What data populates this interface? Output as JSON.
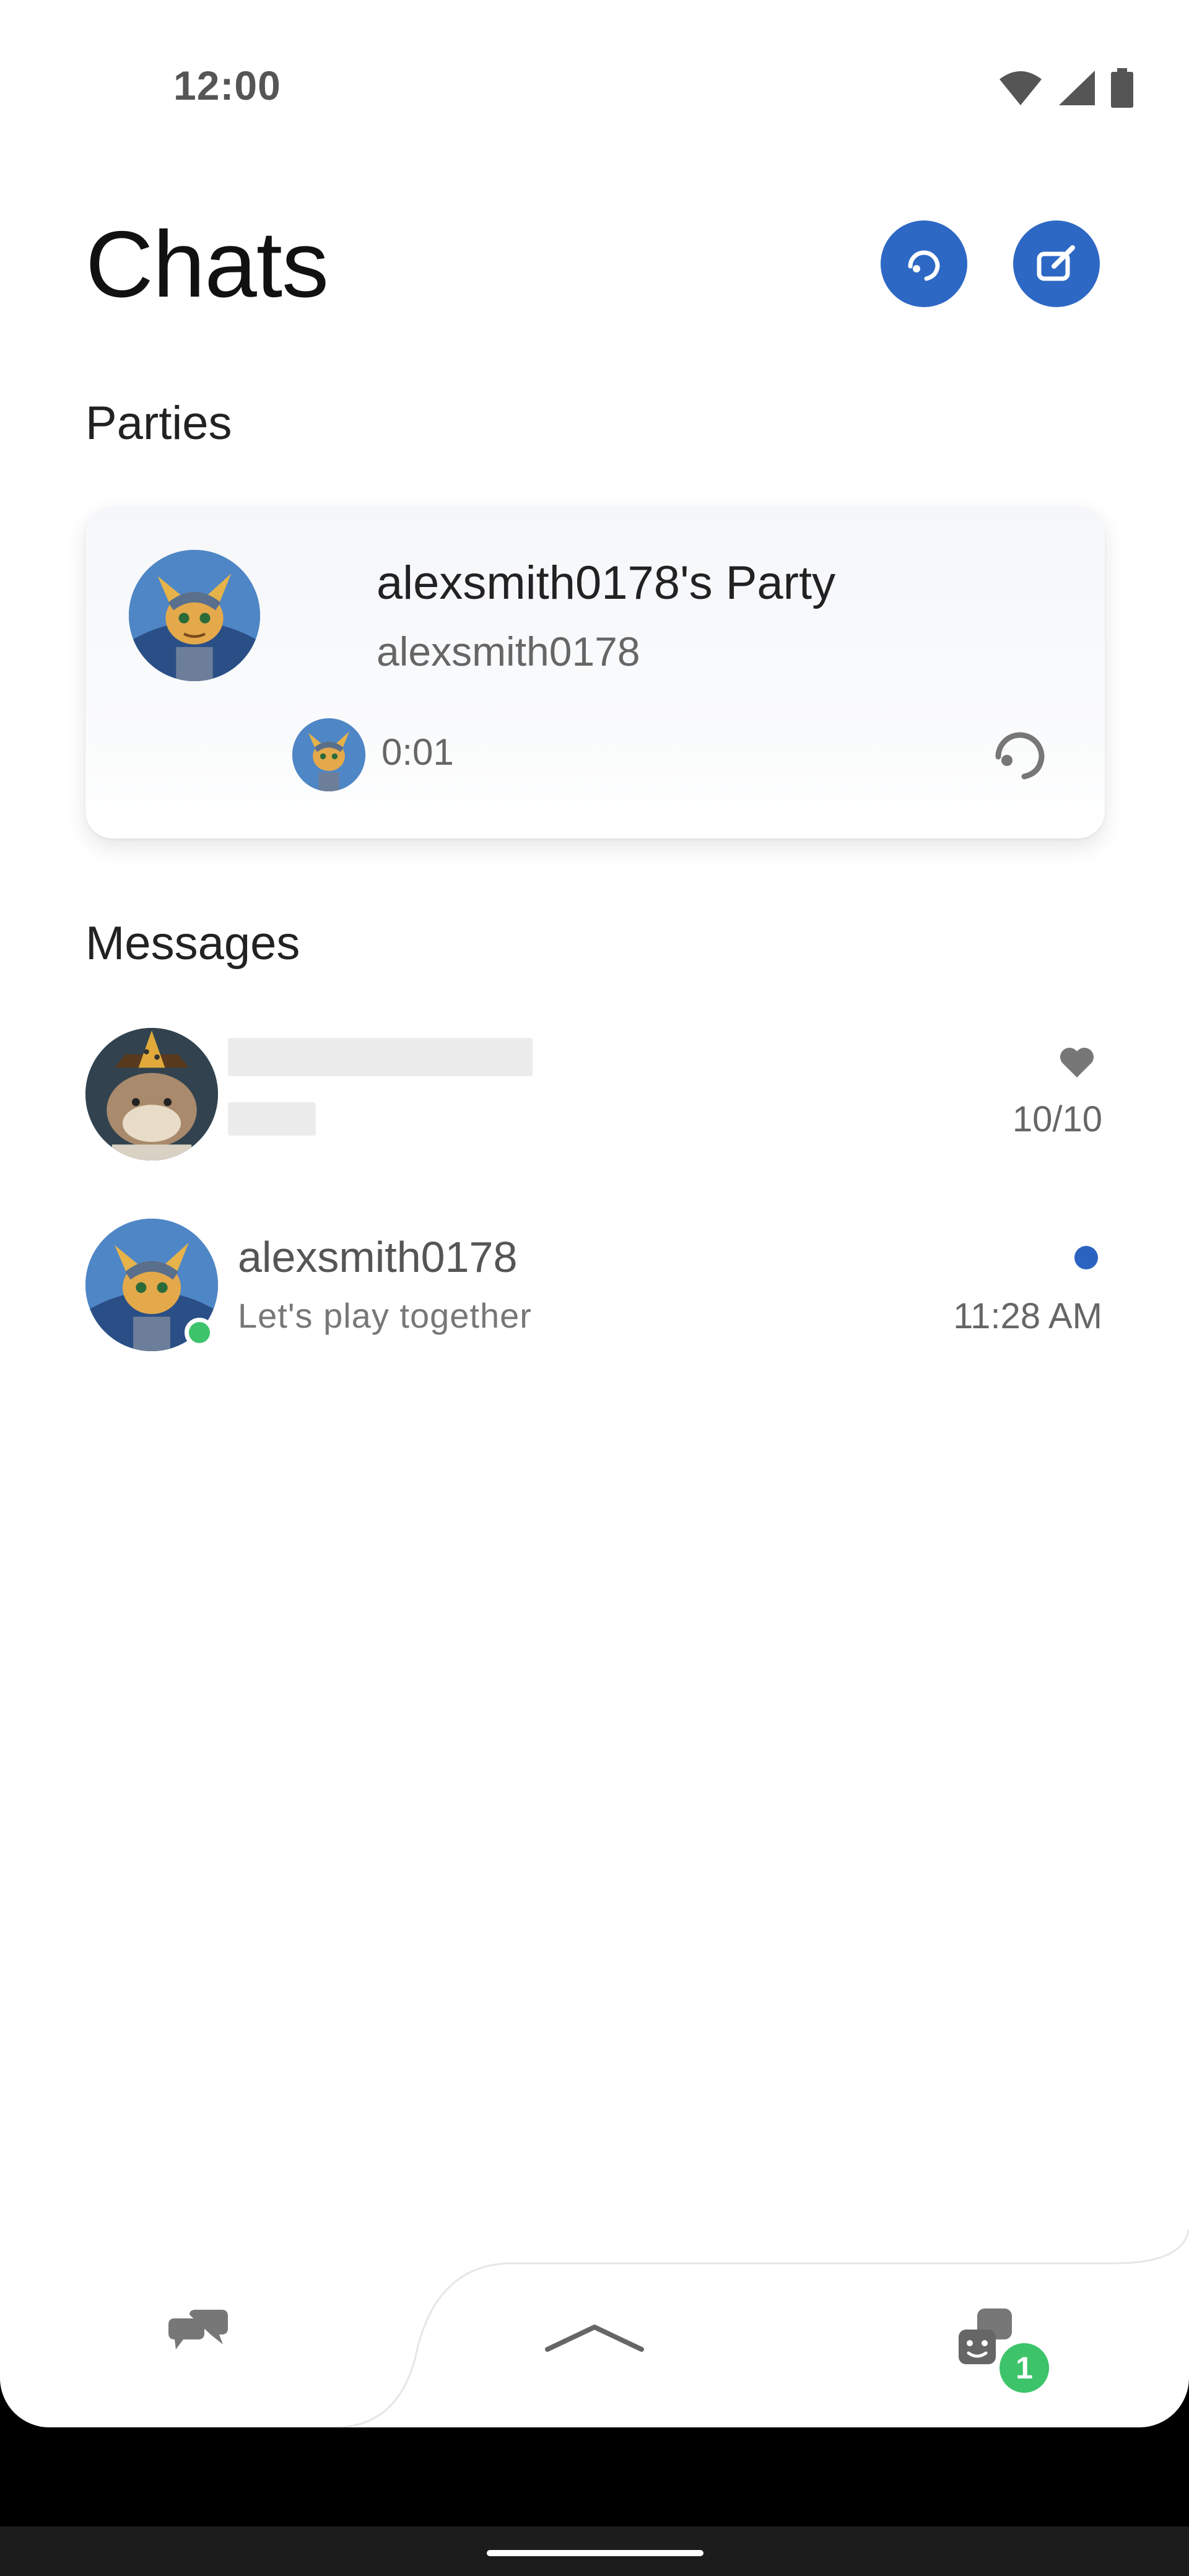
{
  "status_bar": {
    "time": "12:00"
  },
  "header": {
    "title": "Chats"
  },
  "sections": {
    "parties": "Parties",
    "messages": "Messages"
  },
  "party": {
    "name": "alexsmith0178's Party",
    "host": "alexsmith0178",
    "duration": "0:01"
  },
  "messages": [
    {
      "name": "",
      "preview": "",
      "time": "10/10",
      "icon": "heart-icon"
    },
    {
      "name": "alexsmith0178",
      "preview": "Let's play together",
      "time": "11:28 AM",
      "unread": true,
      "online": true
    }
  ],
  "bottom_nav": {
    "badge_count": "1"
  },
  "colors": {
    "accent": "#2d68c4",
    "online": "#3dc46a",
    "unread": "#2b63c0"
  }
}
